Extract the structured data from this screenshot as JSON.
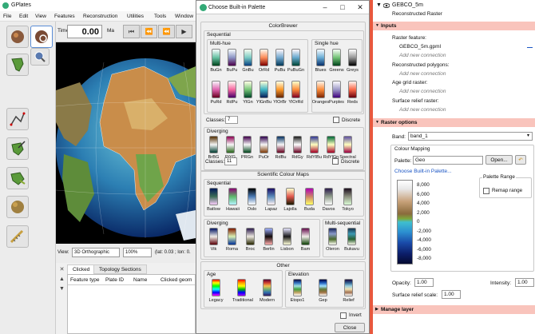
{
  "app": {
    "title": "GPlates",
    "menu": [
      "File",
      "Edit",
      "View",
      "Features",
      "Reconstruction",
      "Utilities",
      "Tools",
      "Window"
    ],
    "time_label": "Time:",
    "time_value": "0.00",
    "time_unit": "Ma",
    "playback": [
      "⏮",
      "⏪",
      "⏪",
      "▶"
    ],
    "view_label": "View:",
    "view_value": "3D Orthographic",
    "zoom_value": "100%",
    "coords_text": "(lat: 0.03 ; lon: 0."
  },
  "tabs": {
    "clicked": "Clicked",
    "topology": "Topology Sections"
  },
  "table": {
    "columns": [
      "Feature type",
      "Plate ID",
      "Name",
      "Clicked geom"
    ]
  },
  "dialog": {
    "title": "Choose Built-in Palette",
    "colorbrewer": "ColorBrewer",
    "sequential": "Sequential",
    "multi_hue": "Multi-hue",
    "single_hue": "Single hue",
    "mh_row1": [
      "BuGn",
      "BuPu",
      "GnBu",
      "OrRd",
      "PuBu",
      "PuBuGn"
    ],
    "mh_row2": [
      "PuRd",
      "RdPu",
      "YlGn",
      "YlGnBu",
      "YlOrBr",
      "YlOrRd"
    ],
    "sh_row1": [
      "Blues",
      "Greens",
      "Greys"
    ],
    "sh_row2": [
      "Oranges",
      "Purples",
      "Reds"
    ],
    "classes_label": "Classes:",
    "classes_value": "7",
    "discrete": "Discrete",
    "diverging": "Diverging",
    "div_names": [
      "BrBG",
      "PiYG",
      "PRGn",
      "PuOr",
      "RdBu",
      "RdGy",
      "RdYlBu",
      "RdYlGn",
      "Spectral"
    ],
    "div_classes_value": "11",
    "scm": "Scientific Colour Maps",
    "scm_seq_names": [
      "Batlow",
      "Hawaii",
      "Oslo",
      "Lapaz",
      "Lajolla",
      "Buda",
      "Davos",
      "Tokyo"
    ],
    "scm_div_names": [
      "Vik",
      "Roma",
      "Broc",
      "Berlin",
      "Lisbon",
      "Bam"
    ],
    "multi_seq": "Multi-sequential",
    "ms_names": [
      "Oleron",
      "Bukavu"
    ],
    "other": "Other",
    "age": "Age",
    "age_names": [
      "Legacy",
      "Traditional",
      "Modern"
    ],
    "elevation": "Elevation",
    "elev_names": [
      "Etopo1",
      "Gep",
      "Relief"
    ],
    "invert": "Invert",
    "close": "Close"
  },
  "panel": {
    "layer_name": "GEBCO_5m",
    "layer_type": "Reconstructed Raster",
    "inputs": "Inputs",
    "raster_feature": "Raster feature:",
    "raster_file": "GEBCO_5m.gpml",
    "add_conn": "Add new connection",
    "recon_poly": "Reconstructed polygons:",
    "age_grid": "Age grid raster:",
    "surface_relief": "Surface relief raster:",
    "raster_options": "Raster options",
    "band_label": "Band:",
    "band_value": "band_1",
    "colour_mapping": "Colour Mapping",
    "palette_label": "Palette:",
    "palette_value": "Geo",
    "open": "Open...",
    "choose_builtin": "Choose Built-in Palette...",
    "palette_range": "Palette Range",
    "remap": "Remap range",
    "ticks": [
      "8,000",
      "6,000",
      "4,000",
      "2,000",
      "0",
      "-2,000",
      "-4,000",
      "-6,000",
      "-8,000"
    ],
    "opacity_label": "Opacity:",
    "opacity_value": "1.00",
    "intensity_label": "Intensity:",
    "intensity_value": "1.00",
    "relief_label": "Surface relief scale:",
    "relief_value": "1.00",
    "manage": "Manage layer"
  },
  "colors": {
    "accent": "#e8583e",
    "panel_header": "#f9c4bc",
    "link": "#1a55c4"
  }
}
